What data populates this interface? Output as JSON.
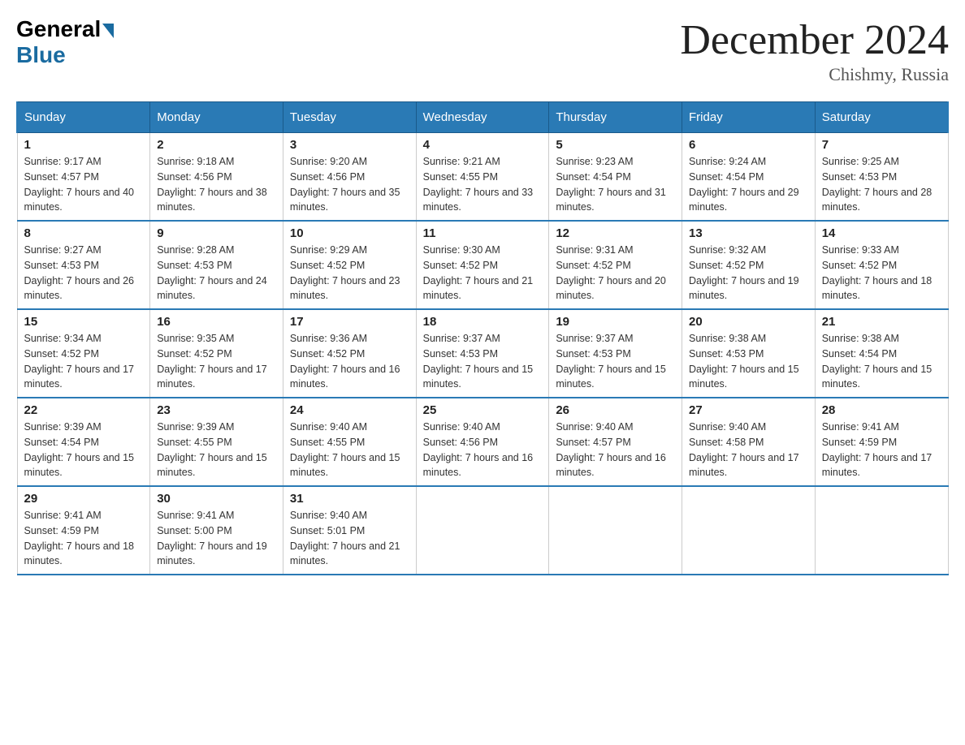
{
  "header": {
    "logo_general": "General",
    "logo_blue": "Blue",
    "month_title": "December 2024",
    "location": "Chishmy, Russia"
  },
  "days_of_week": [
    "Sunday",
    "Monday",
    "Tuesday",
    "Wednesday",
    "Thursday",
    "Friday",
    "Saturday"
  ],
  "weeks": [
    [
      {
        "day": "1",
        "sunrise": "9:17 AM",
        "sunset": "4:57 PM",
        "daylight": "7 hours and 40 minutes."
      },
      {
        "day": "2",
        "sunrise": "9:18 AM",
        "sunset": "4:56 PM",
        "daylight": "7 hours and 38 minutes."
      },
      {
        "day": "3",
        "sunrise": "9:20 AM",
        "sunset": "4:56 PM",
        "daylight": "7 hours and 35 minutes."
      },
      {
        "day": "4",
        "sunrise": "9:21 AM",
        "sunset": "4:55 PM",
        "daylight": "7 hours and 33 minutes."
      },
      {
        "day": "5",
        "sunrise": "9:23 AM",
        "sunset": "4:54 PM",
        "daylight": "7 hours and 31 minutes."
      },
      {
        "day": "6",
        "sunrise": "9:24 AM",
        "sunset": "4:54 PM",
        "daylight": "7 hours and 29 minutes."
      },
      {
        "day": "7",
        "sunrise": "9:25 AM",
        "sunset": "4:53 PM",
        "daylight": "7 hours and 28 minutes."
      }
    ],
    [
      {
        "day": "8",
        "sunrise": "9:27 AM",
        "sunset": "4:53 PM",
        "daylight": "7 hours and 26 minutes."
      },
      {
        "day": "9",
        "sunrise": "9:28 AM",
        "sunset": "4:53 PM",
        "daylight": "7 hours and 24 minutes."
      },
      {
        "day": "10",
        "sunrise": "9:29 AM",
        "sunset": "4:52 PM",
        "daylight": "7 hours and 23 minutes."
      },
      {
        "day": "11",
        "sunrise": "9:30 AM",
        "sunset": "4:52 PM",
        "daylight": "7 hours and 21 minutes."
      },
      {
        "day": "12",
        "sunrise": "9:31 AM",
        "sunset": "4:52 PM",
        "daylight": "7 hours and 20 minutes."
      },
      {
        "day": "13",
        "sunrise": "9:32 AM",
        "sunset": "4:52 PM",
        "daylight": "7 hours and 19 minutes."
      },
      {
        "day": "14",
        "sunrise": "9:33 AM",
        "sunset": "4:52 PM",
        "daylight": "7 hours and 18 minutes."
      }
    ],
    [
      {
        "day": "15",
        "sunrise": "9:34 AM",
        "sunset": "4:52 PM",
        "daylight": "7 hours and 17 minutes."
      },
      {
        "day": "16",
        "sunrise": "9:35 AM",
        "sunset": "4:52 PM",
        "daylight": "7 hours and 17 minutes."
      },
      {
        "day": "17",
        "sunrise": "9:36 AM",
        "sunset": "4:52 PM",
        "daylight": "7 hours and 16 minutes."
      },
      {
        "day": "18",
        "sunrise": "9:37 AM",
        "sunset": "4:53 PM",
        "daylight": "7 hours and 15 minutes."
      },
      {
        "day": "19",
        "sunrise": "9:37 AM",
        "sunset": "4:53 PM",
        "daylight": "7 hours and 15 minutes."
      },
      {
        "day": "20",
        "sunrise": "9:38 AM",
        "sunset": "4:53 PM",
        "daylight": "7 hours and 15 minutes."
      },
      {
        "day": "21",
        "sunrise": "9:38 AM",
        "sunset": "4:54 PM",
        "daylight": "7 hours and 15 minutes."
      }
    ],
    [
      {
        "day": "22",
        "sunrise": "9:39 AM",
        "sunset": "4:54 PM",
        "daylight": "7 hours and 15 minutes."
      },
      {
        "day": "23",
        "sunrise": "9:39 AM",
        "sunset": "4:55 PM",
        "daylight": "7 hours and 15 minutes."
      },
      {
        "day": "24",
        "sunrise": "9:40 AM",
        "sunset": "4:55 PM",
        "daylight": "7 hours and 15 minutes."
      },
      {
        "day": "25",
        "sunrise": "9:40 AM",
        "sunset": "4:56 PM",
        "daylight": "7 hours and 16 minutes."
      },
      {
        "day": "26",
        "sunrise": "9:40 AM",
        "sunset": "4:57 PM",
        "daylight": "7 hours and 16 minutes."
      },
      {
        "day": "27",
        "sunrise": "9:40 AM",
        "sunset": "4:58 PM",
        "daylight": "7 hours and 17 minutes."
      },
      {
        "day": "28",
        "sunrise": "9:41 AM",
        "sunset": "4:59 PM",
        "daylight": "7 hours and 17 minutes."
      }
    ],
    [
      {
        "day": "29",
        "sunrise": "9:41 AM",
        "sunset": "4:59 PM",
        "daylight": "7 hours and 18 minutes."
      },
      {
        "day": "30",
        "sunrise": "9:41 AM",
        "sunset": "5:00 PM",
        "daylight": "7 hours and 19 minutes."
      },
      {
        "day": "31",
        "sunrise": "9:40 AM",
        "sunset": "5:01 PM",
        "daylight": "7 hours and 21 minutes."
      },
      null,
      null,
      null,
      null
    ]
  ],
  "labels": {
    "sunrise_prefix": "Sunrise: ",
    "sunset_prefix": "Sunset: ",
    "daylight_prefix": "Daylight: "
  }
}
